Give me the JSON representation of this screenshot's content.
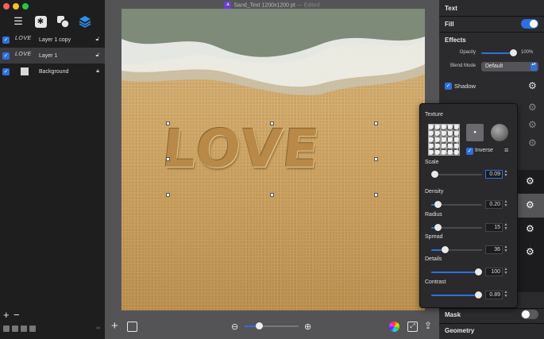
{
  "window": {
    "title": "Sand_Text 1200x1200 pt",
    "edited": "— Edited"
  },
  "layers": [
    {
      "thumb": "LOVE",
      "name": "Layer 1 copy",
      "locked": false
    },
    {
      "thumb": "LOVE",
      "name": "Layer 1",
      "locked": false
    },
    {
      "thumb": "",
      "name": "Background",
      "locked": true
    }
  ],
  "canvas": {
    "text": "LOVE"
  },
  "inspector": {
    "text_header": "Text",
    "fill_label": "Fill",
    "effects_header": "Effects",
    "opacity_label": "Opacity",
    "opacity_value": "100%",
    "opacity_fraction": 1.0,
    "blend_label": "Blend Mode",
    "blend_value": "Default",
    "shadow_label": "Shadow",
    "mask_label": "Mask",
    "geometry_label": "Geometry"
  },
  "popover": {
    "texture_label": "Texture",
    "inverse_label": "Inverse",
    "scale_label": "Scale",
    "scale_value": "0.09",
    "scale_fraction": 0.03,
    "density_label": "Density",
    "density_value": "0.20",
    "density_fraction": 0.12,
    "radius_label": "Radius",
    "radius_value": "15",
    "radius_fraction": 0.12,
    "spread_label": "Spread",
    "spread_value": "36",
    "spread_fraction": 0.26,
    "details_label": "Details",
    "details_value": "100",
    "details_fraction": 1.0,
    "contrast_label": "Contrast",
    "contrast_value": "0.89",
    "contrast_fraction": 1.0
  },
  "colors": {
    "accent": "#2f6fe0",
    "sidebar": "#1e1e1e",
    "canvas_bg": "#545456"
  }
}
